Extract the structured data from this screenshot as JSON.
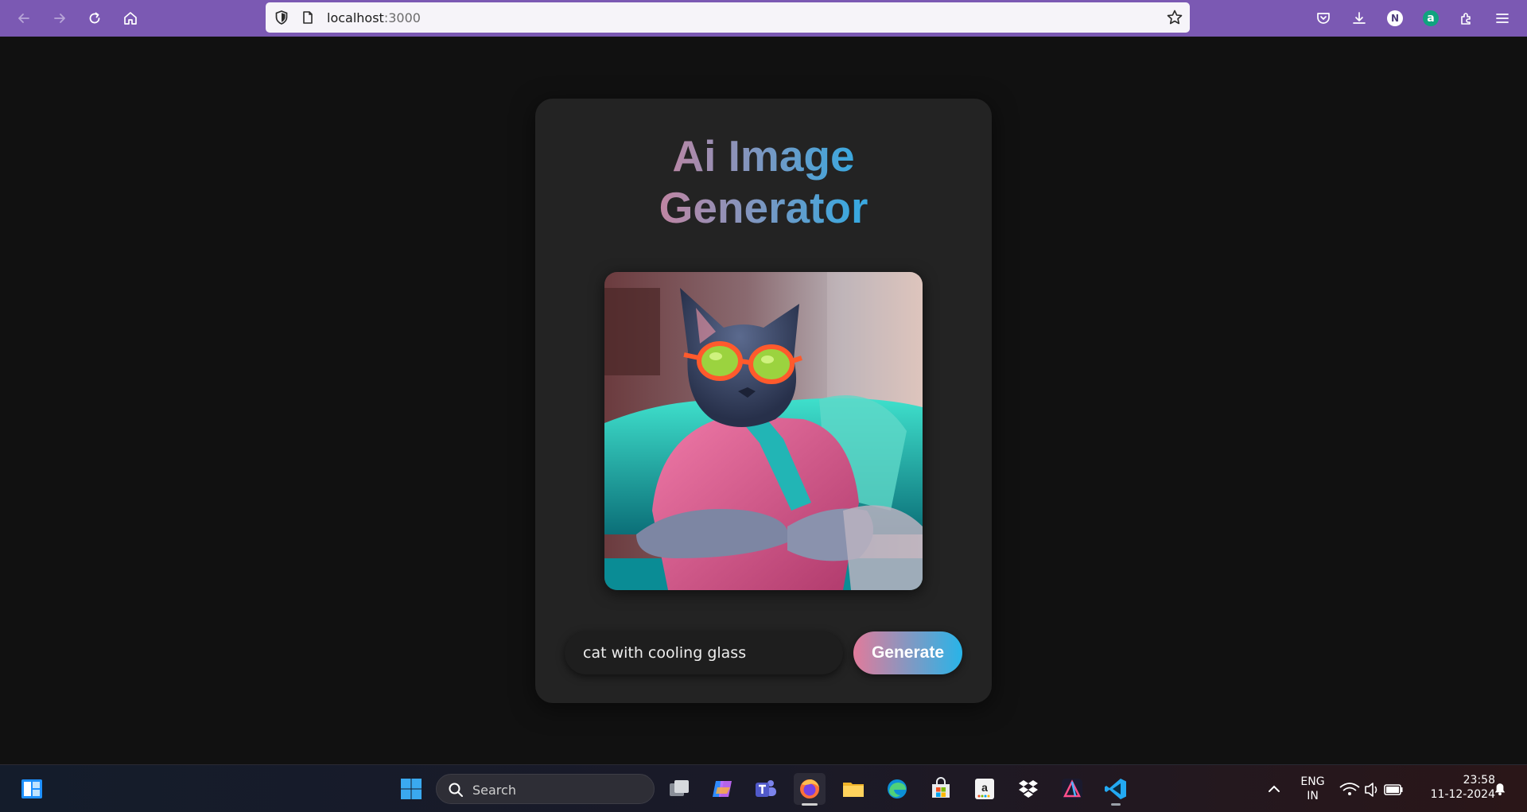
{
  "browser": {
    "url_host": "localhost",
    "url_port": ":3000"
  },
  "app": {
    "title_line1": "Ai Image",
    "title_line2": "Generator",
    "image_alt": "cat with cooling glass",
    "prompt_value": "cat with cooling glass",
    "generate_label": "Generate"
  },
  "taskbar": {
    "search_label": "Search",
    "lang_line1": "ENG",
    "lang_line2": "IN",
    "time": "23:58",
    "date": "11-12-2024"
  },
  "colors": {
    "browser_bar": "#7b59b3",
    "card_bg": "#232323",
    "page_bg": "#111111",
    "title_gradient_start": "#c7839f",
    "title_gradient_end": "#3aa8df",
    "button_gradient_start": "#e17b9b",
    "button_gradient_end": "#28b4e8"
  },
  "icons": {
    "toolbar_left": [
      "back-arrow-icon",
      "forward-arrow-icon",
      "reload-icon",
      "home-icon"
    ],
    "toolbar_right": [
      "pocket-icon",
      "download-icon",
      "profile-icon",
      "chatgpt-extension-icon",
      "extensions-icon",
      "menu-icon"
    ],
    "taskbar": [
      "widgets-icon",
      "windows-start-icon",
      "search-icon",
      "task-view-icon",
      "copilot-icon",
      "teams-icon",
      "firefox-icon",
      "file-explorer-icon",
      "edge-icon",
      "microsoft-store-icon",
      "amazon-icon",
      "dropbox-icon",
      "affinity-icon",
      "vscode-icon",
      "chevron-up-icon",
      "wifi-icon",
      "volume-icon",
      "battery-icon",
      "notification-bell-icon"
    ]
  }
}
